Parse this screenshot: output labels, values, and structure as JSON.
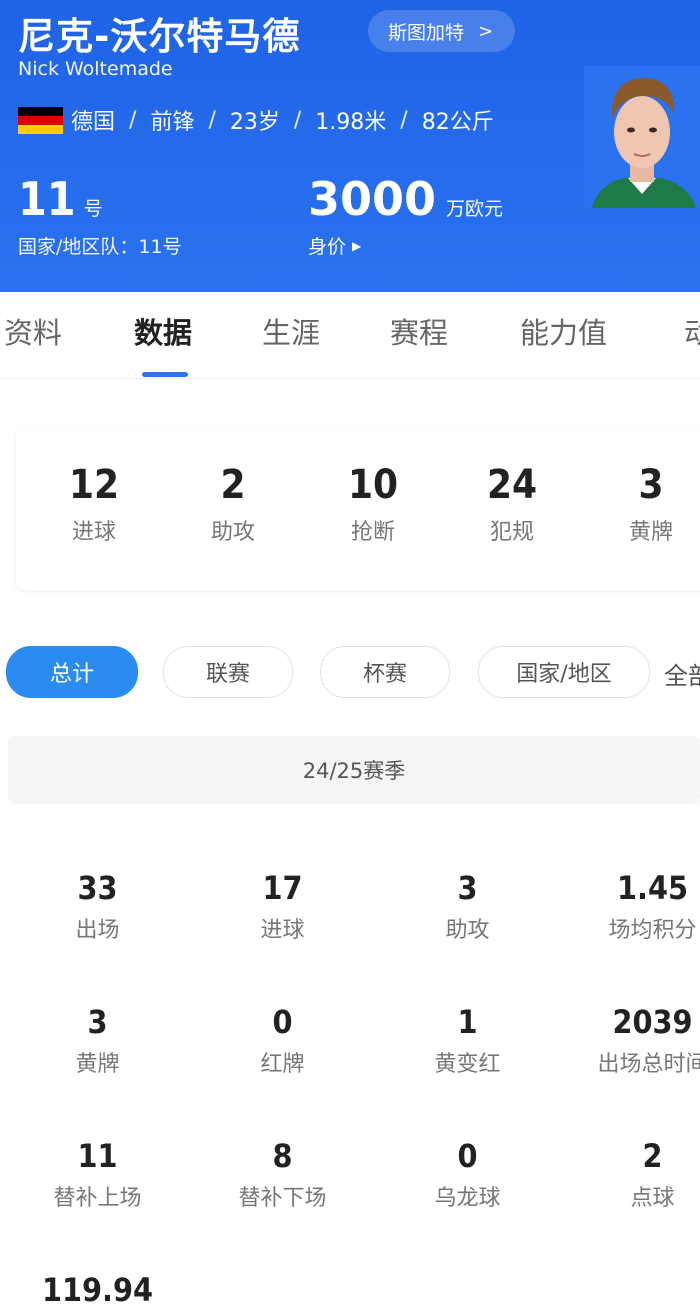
{
  "player": {
    "name_cn": "尼克-沃尔特马德",
    "name_en": "Nick  Woltemade",
    "club": "斯图加特",
    "club_chevron": ">",
    "country": "德国",
    "position": "前锋",
    "age": "23岁",
    "height": "1.98米",
    "weight": "82公斤",
    "separator": "/",
    "number": "11",
    "number_unit": "号",
    "national_team": "国家/地区队：11号",
    "value": "3000",
    "value_unit": "万欧元",
    "value_label": "身价",
    "flag_colors": [
      "#000000",
      "#dd0000",
      "#ffce00"
    ],
    "avatar_icon": "player-photo"
  },
  "tabs": [
    {
      "label": "资料",
      "active": false
    },
    {
      "label": "数据",
      "active": true
    },
    {
      "label": "生涯",
      "active": false
    },
    {
      "label": "赛程",
      "active": false
    },
    {
      "label": "能力值",
      "active": false
    },
    {
      "label": "动",
      "active": false
    }
  ],
  "summary": [
    {
      "value": "12",
      "label": "进球"
    },
    {
      "value": "2",
      "label": "助攻"
    },
    {
      "value": "10",
      "label": "抢断"
    },
    {
      "value": "24",
      "label": "犯规"
    },
    {
      "value": "3",
      "label": "黄牌"
    }
  ],
  "filters": [
    {
      "label": "总计",
      "active": true
    },
    {
      "label": "联赛",
      "active": false
    },
    {
      "label": "杯赛",
      "active": false
    },
    {
      "label": "国家/地区",
      "active": false
    },
    {
      "label": "全部",
      "active": false
    }
  ],
  "season": "24/25赛季",
  "stats": [
    {
      "value": "33",
      "label": "出场"
    },
    {
      "value": "17",
      "label": "进球"
    },
    {
      "value": "3",
      "label": "助攻"
    },
    {
      "value": "1.45",
      "label": "场均积分"
    },
    {
      "value": "3",
      "label": "黄牌"
    },
    {
      "value": "0",
      "label": "红牌"
    },
    {
      "value": "1",
      "label": "黄变红"
    },
    {
      "value": "2039",
      "label": "出场总时间"
    },
    {
      "value": "11",
      "label": "替补上场"
    },
    {
      "value": "8",
      "label": "替补下场"
    },
    {
      "value": "0",
      "label": "乌龙球"
    },
    {
      "value": "2",
      "label": "点球"
    },
    {
      "value": "119.94",
      "label": ""
    }
  ],
  "colors": {
    "header_blue": "#2a72f0",
    "accent_blue": "#2a8cf0"
  }
}
